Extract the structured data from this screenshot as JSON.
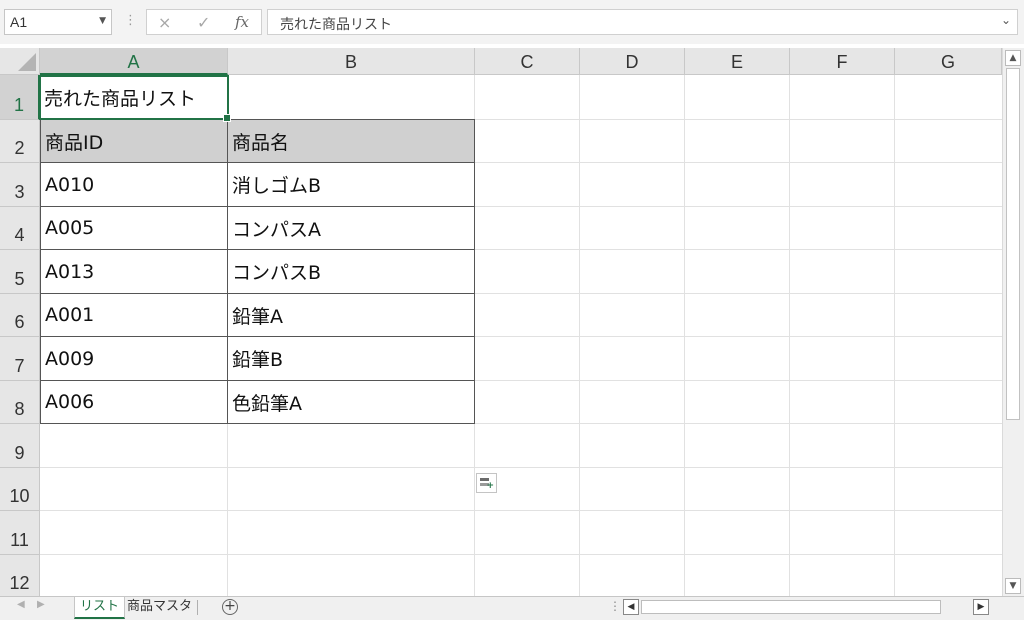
{
  "formula_bar": {
    "name_box": "A1",
    "cancel_icon": "×",
    "enter_icon": "✓",
    "fx_label": "fx",
    "content": "売れた商品リスト"
  },
  "columns": [
    "A",
    "B",
    "C",
    "D",
    "E",
    "F",
    "G"
  ],
  "rows": [
    "1",
    "2",
    "3",
    "4",
    "5",
    "6",
    "7",
    "8",
    "9",
    "10",
    "11",
    "12"
  ],
  "sheet": {
    "title": "売れた商品リスト",
    "table_headers": [
      "商品ID",
      "商品名"
    ],
    "table_rows": [
      [
        "A010",
        "消しゴムB"
      ],
      [
        "A005",
        "コンパスA"
      ],
      [
        "A013",
        "コンパスB"
      ],
      [
        "A001",
        "鉛筆A"
      ],
      [
        "A009",
        "鉛筆B"
      ],
      [
        "A006",
        "色鉛筆A"
      ]
    ]
  },
  "tabs": {
    "items": [
      "リスト",
      "商品マスタ"
    ],
    "active": "リスト"
  },
  "colors": {
    "accent": "#217346",
    "header_fill": "#d0d0d0"
  }
}
